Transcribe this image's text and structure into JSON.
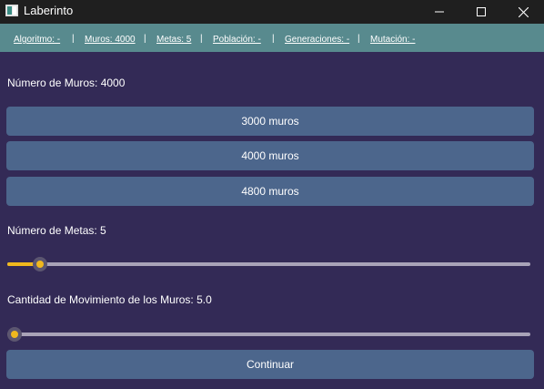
{
  "window": {
    "title": "Laberinto",
    "icon": "app-window-icon",
    "controls": [
      "minimize-icon",
      "maximize-icon",
      "close-icon"
    ]
  },
  "menu": {
    "items": [
      "Algoritmo: -",
      "Muros: 4000",
      "Metas: 5",
      "Población: -",
      "Generaciones: -",
      "Mutación: -"
    ],
    "separator": "|"
  },
  "walls": {
    "label": "Número de Muros: 4000",
    "options": [
      "3000 muros",
      "4000 muros",
      "4800 muros"
    ]
  },
  "goals": {
    "label": "Número de Metas: 5",
    "slider_fraction": 0.05
  },
  "movement": {
    "label": "Cantidad de Movimiento de los Muros: 5.0",
    "slider_fraction": 0.0
  },
  "continue_label": "Continuar",
  "colors": {
    "background": "#332a56",
    "titlebar": "#1f1f1f",
    "menubar": "#588a8e",
    "button": "#4c668c",
    "slider_accent": "#f0b81e",
    "slider_track": "#a9a3b8"
  }
}
